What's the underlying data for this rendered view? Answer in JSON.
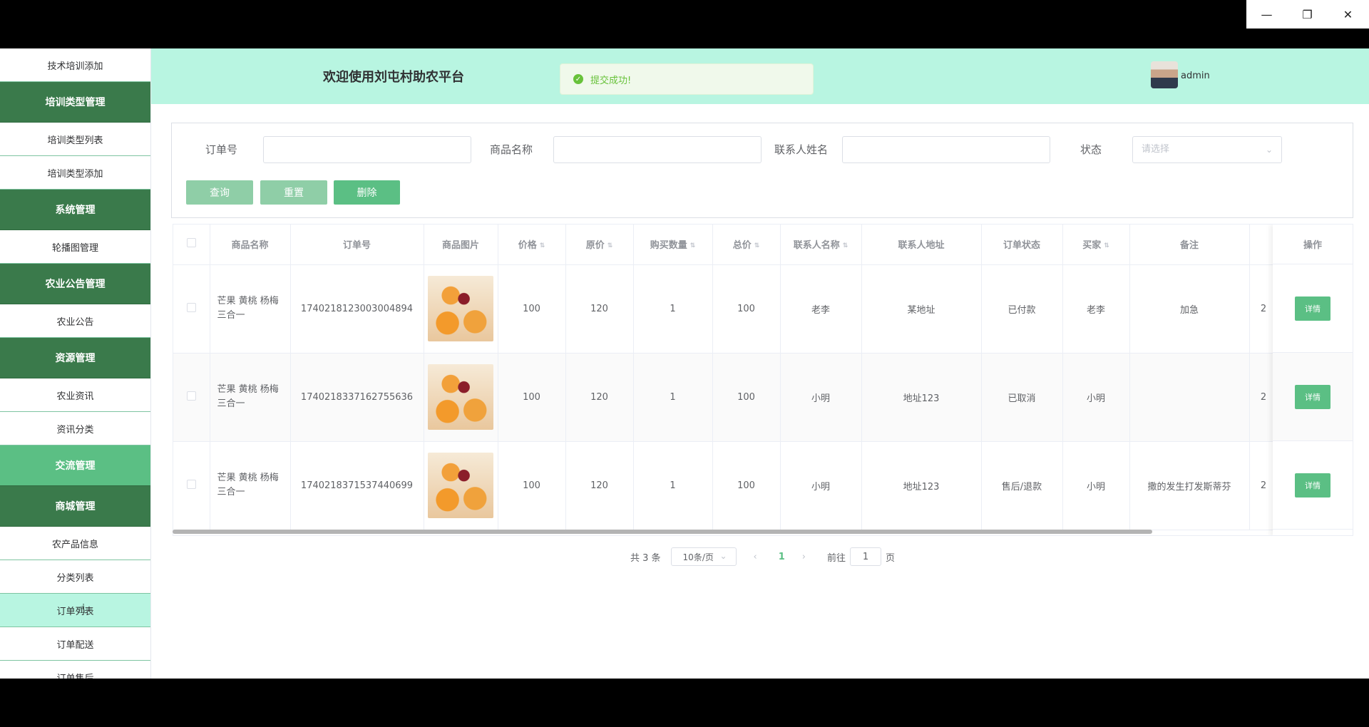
{
  "window": {
    "minimize_glyph": "—",
    "restore_glyph": "❐",
    "close_glyph": "✕"
  },
  "sidebar": {
    "items": [
      {
        "label": "技术培训添加",
        "kind": "item"
      },
      {
        "label": "培训类型管理",
        "kind": "group"
      },
      {
        "label": "培训类型列表",
        "kind": "item"
      },
      {
        "label": "培训类型添加",
        "kind": "item"
      },
      {
        "label": "系统管理",
        "kind": "group"
      },
      {
        "label": "轮播图管理",
        "kind": "item"
      },
      {
        "label": "农业公告管理",
        "kind": "group"
      },
      {
        "label": "农业公告",
        "kind": "item"
      },
      {
        "label": "资源管理",
        "kind": "group"
      },
      {
        "label": "农业资讯",
        "kind": "item"
      },
      {
        "label": "资讯分类",
        "kind": "item"
      },
      {
        "label": "交流管理",
        "kind": "group-active"
      },
      {
        "label": "商城管理",
        "kind": "group"
      },
      {
        "label": "农产品信息",
        "kind": "item"
      },
      {
        "label": "分类列表",
        "kind": "item"
      },
      {
        "label": "订单列表",
        "kind": "item-hover"
      },
      {
        "label": "订单配送",
        "kind": "item"
      },
      {
        "label": "订单售后",
        "kind": "item"
      }
    ]
  },
  "header": {
    "title": "欢迎使用刘屯村助农平台",
    "toast": "提交成功!",
    "username": "admin"
  },
  "search": {
    "order_no_label": "订单号",
    "product_name_label": "商品名称",
    "contact_name_label": "联系人姓名",
    "status_label": "状态",
    "status_placeholder": "请选择",
    "query_button": "查询",
    "reset_button": "重置",
    "delete_button": "删除"
  },
  "table": {
    "columns": [
      "商品名称",
      "订单号",
      "商品图片",
      "价格",
      "原价",
      "购买数量",
      "总价",
      "联系人名称",
      "联系人地址",
      "订单状态",
      "买家",
      "备注",
      "操作"
    ],
    "rows": [
      {
        "product": "芒果 黄桃 杨梅三合一",
        "order_no": "1740218123003004894",
        "price": "100",
        "original": "120",
        "qty": "1",
        "total": "100",
        "contact": "老李",
        "address": "某地址",
        "status": "已付款",
        "buyer": "老李",
        "remark": "加急",
        "extra": "2"
      },
      {
        "product": "芒果 黄桃 杨梅三合一",
        "order_no": "1740218337162755636",
        "price": "100",
        "original": "120",
        "qty": "1",
        "total": "100",
        "contact": "小明",
        "address": "地址123",
        "status": "已取消",
        "buyer": "小明",
        "remark": "",
        "extra": "2"
      },
      {
        "product": "芒果 黄桃 杨梅三合一",
        "order_no": "1740218371537440699",
        "price": "100",
        "original": "120",
        "qty": "1",
        "total": "100",
        "contact": "小明",
        "address": "地址123",
        "status": "售后/退款",
        "buyer": "小明",
        "remark": "撒的发生打发斯蒂芬",
        "extra": "2"
      }
    ],
    "detail_button": "详情"
  },
  "pagination": {
    "total": "共 3 条",
    "page_size": "10条/页",
    "current_page": "1",
    "goto_label": "前往",
    "goto_value": "1",
    "page_suffix": "页"
  },
  "colors": {
    "accent": "#5bbf84",
    "group_bg": "#3a7a4b",
    "header_bg": "#b8f5e1"
  }
}
